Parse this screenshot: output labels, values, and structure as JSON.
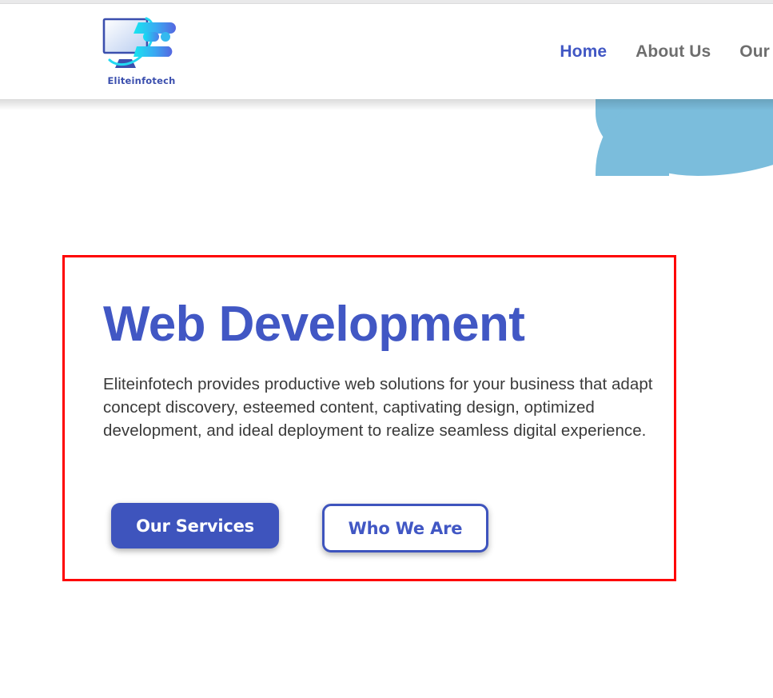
{
  "colors": {
    "brand_blue": "#4157c4",
    "button_blue": "#3e54bd",
    "nav_inactive": "#6e6e6e",
    "body_text": "#3a3a3a",
    "blob_blue": "#7bbddc",
    "annotation_red": "#fe0000",
    "header_bg": "#ffffff",
    "page_bg": "#ffffff"
  },
  "header": {
    "logo": {
      "icon": "monitor-logo-icon",
      "wordmark": "Eliteinfotech"
    },
    "nav": {
      "items": [
        {
          "label": "Home",
          "active": true,
          "clipped": false
        },
        {
          "label": "About Us",
          "active": false,
          "clipped": false
        },
        {
          "label": "Our Ser",
          "active": false,
          "clipped": true
        }
      ]
    }
  },
  "hero": {
    "title": "Web Development",
    "description": "Eliteinfotech provides productive web solutions for your business that adapt concept discovery, esteemed content, captivating design, optimized development, and ideal deployment to realize seamless digital experience.",
    "buttons": {
      "primary": "Our Services",
      "secondary": "Who We Are"
    },
    "decor": {
      "blob": "hero-blob-shape"
    }
  },
  "annotation": {
    "label": "highlight-region",
    "color": "#fe0000"
  }
}
